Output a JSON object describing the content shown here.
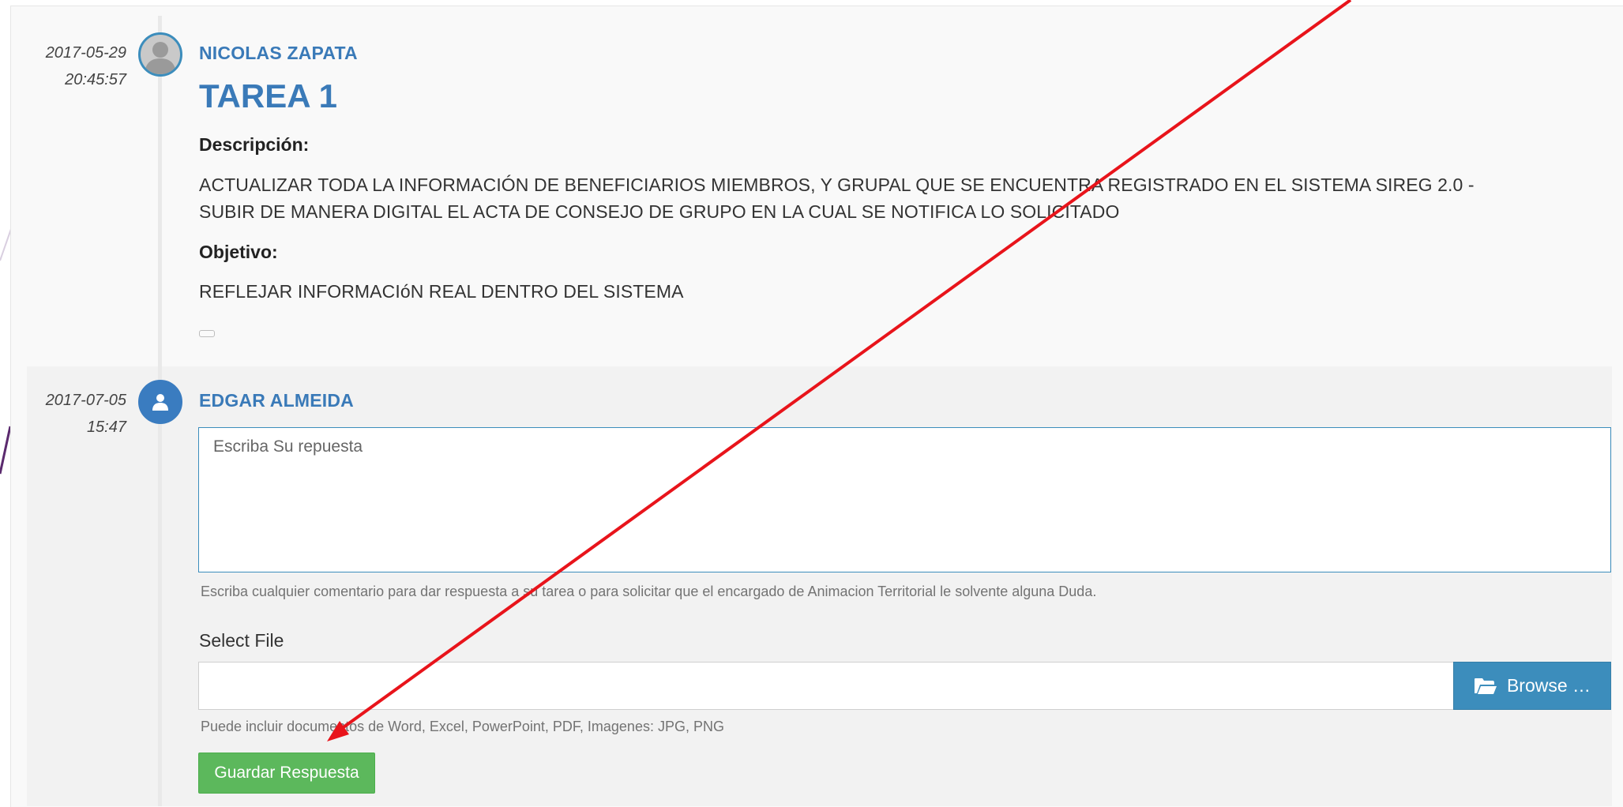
{
  "first_entry": {
    "date": "2017-05-29",
    "time": "20:45:57",
    "author": "NICOLAS ZAPATA",
    "task_title": "TAREA 1",
    "description_label": "Descripción:",
    "description_line1": "ACTUALIZAR TODA LA INFORMACIÓN DE BENEFICIARIOS MIEMBROS, Y GRUPAL QUE SE ENCUENTRA REGISTRADO EN EL SISTEMA SIREG 2.0 -",
    "description_line2": "SUBIR DE MANERA DIGITAL EL ACTA DE CONSEJO DE GRUPO EN LA CUAL SE NOTIFICA LO SOLICITADO",
    "objective_label": "Objetivo:",
    "objective_text": "REFLEJAR INFORMACIóN REAL DENTRO DEL SISTEMA",
    "avatar_icon": "user-silhouette-icon"
  },
  "reply_entry": {
    "date": "2017-07-05",
    "time": "15:47",
    "author": "EDGAR ALMEIDA",
    "avatar_icon": "user-icon",
    "textarea_placeholder": "Escriba Su repuesta",
    "textarea_help": "Escriba cualquier comentario para dar respuesta a su tarea o para solicitar que el encargado de Animacion Territorial le solvente alguna Duda.",
    "file_label": "Select File",
    "browse_label": "Browse …",
    "browse_icon": "folder-open-icon",
    "file_help": "Puede incluir documentos de Word, Excel, PowerPoint, PDF, Imagenes: JPG, PNG",
    "save_label": "Guardar Respuesta"
  },
  "colors": {
    "author_blue": "#3a7ab8",
    "browse_blue": "#3c8dbc",
    "save_green": "#5cb85c",
    "annotation_arrow": "#e8141b"
  }
}
